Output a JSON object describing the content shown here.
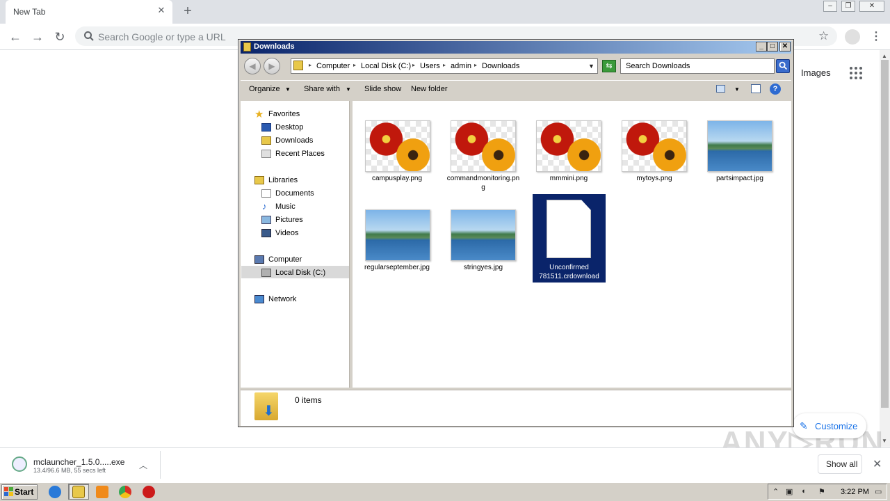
{
  "browser": {
    "tab_title": "New Tab",
    "omnibox_placeholder": "Search Google or type a URL",
    "images_link": "Images",
    "customize_label": "Customize",
    "watermark": "ANY RUN"
  },
  "download_shelf": {
    "file_name": "mclauncher_1.5.0.....exe",
    "status": "13.4/96.6 MB, 55 secs left",
    "show_all": "Show all"
  },
  "explorer": {
    "title": "Downloads",
    "breadcrumbs": [
      "Computer",
      "Local Disk (C:)",
      "Users",
      "admin",
      "Downloads"
    ],
    "search_placeholder": "Search Downloads",
    "commands": {
      "organize": "Organize",
      "share_with": "Share with",
      "slide_show": "Slide show",
      "new_folder": "New folder"
    },
    "nav": {
      "favorites": "Favorites",
      "desktop": "Desktop",
      "downloads": "Downloads",
      "recent": "Recent Places",
      "libraries": "Libraries",
      "documents": "Documents",
      "music": "Music",
      "pictures": "Pictures",
      "videos": "Videos",
      "computer": "Computer",
      "local_disk": "Local Disk (C:)",
      "network": "Network"
    },
    "files": [
      {
        "name": "campusplay.png",
        "kind": "flower"
      },
      {
        "name": "commandmonitoring.png",
        "kind": "flower"
      },
      {
        "name": "mmmini.png",
        "kind": "flower"
      },
      {
        "name": "mytoys.png",
        "kind": "flower"
      },
      {
        "name": "partsimpact.jpg",
        "kind": "lake"
      },
      {
        "name": "regularseptember.jpg",
        "kind": "lake"
      },
      {
        "name": "stringyes.jpg",
        "kind": "lake"
      },
      {
        "name": "Unconfirmed 781511.crdownload",
        "kind": "document",
        "selected": true
      }
    ],
    "items_count": "0 items"
  },
  "taskbar": {
    "start_label": "Start",
    "clock": "3:22 PM"
  }
}
